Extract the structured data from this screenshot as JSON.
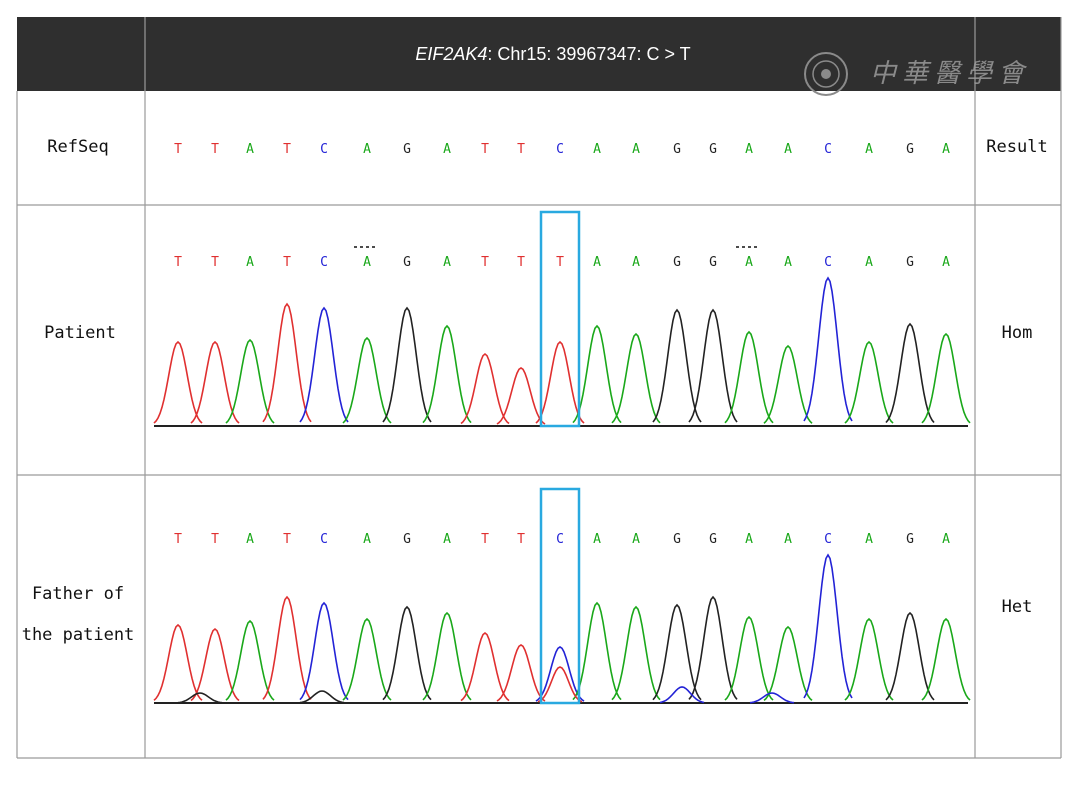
{
  "header": {
    "gene": "EIF2AK4",
    "variant": ": Chr15: 39967347: C > T",
    "watermark": "中華醫學會"
  },
  "rows": {
    "refseq": {
      "label": "RefSeq",
      "result": "Result"
    },
    "patient": {
      "label": "Patient",
      "result": "Hom"
    },
    "father": {
      "label_line1": "Father of",
      "label_line2": "the patient",
      "result": "Het"
    }
  },
  "sequences": {
    "refseq": [
      "T",
      "T",
      "A",
      "T",
      "C",
      "A",
      "G",
      "A",
      "T",
      "T",
      "C",
      "A",
      "A",
      "G",
      "G",
      "A",
      "A",
      "C",
      "A",
      "G",
      "A"
    ],
    "patient": [
      "T",
      "T",
      "A",
      "T",
      "C",
      "A",
      "G",
      "A",
      "T",
      "T",
      "T",
      "A",
      "A",
      "G",
      "G",
      "A",
      "A",
      "C",
      "A",
      "G",
      "A"
    ],
    "father": [
      "T",
      "T",
      "A",
      "T",
      "C",
      "A",
      "G",
      "A",
      "T",
      "T",
      "C",
      "A",
      "A",
      "G",
      "G",
      "A",
      "A",
      "C",
      "A",
      "G",
      "A"
    ]
  },
  "base_colors": {
    "A": "#1aa81a",
    "C": "#2323d6",
    "G": "#222222",
    "T": "#e03030"
  },
  "highlight_color": "#29a9e0",
  "header_bg": "#2f2f2f"
}
